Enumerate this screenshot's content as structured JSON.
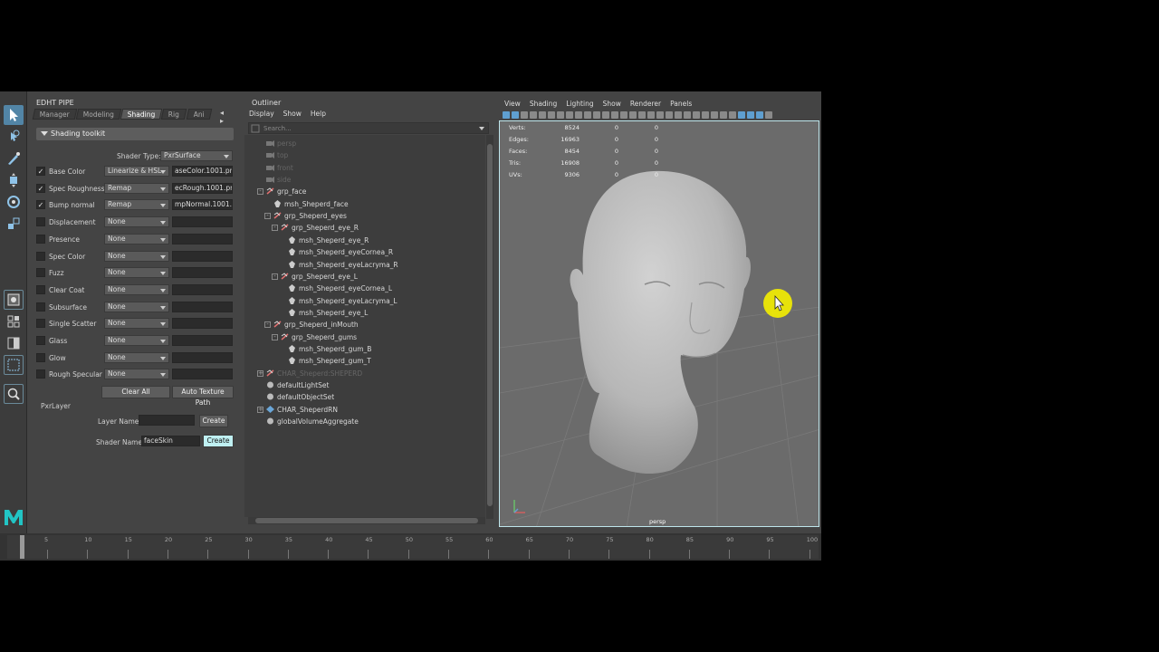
{
  "left_panel": {
    "title": "EDHT PIPE",
    "tabs": [
      {
        "label": "Manager",
        "active": false
      },
      {
        "label": "Modeling",
        "active": false
      },
      {
        "label": "Shading",
        "active": true
      },
      {
        "label": "Rig",
        "active": false
      },
      {
        "label": "Ani",
        "active": false
      }
    ],
    "tab_arrows": "◂ ▸",
    "toolkit_header": "Shading toolkit",
    "shader_type_label": "Shader Type:",
    "shader_type_value": "PxrSurface",
    "attributes": [
      {
        "label": "Base Color",
        "checked": true,
        "mode": "Linearize & HSL",
        "file": "aseColor.1001.png"
      },
      {
        "label": "Spec Roughness",
        "checked": true,
        "mode": "Remap",
        "file": "ecRough.1001.png"
      },
      {
        "label": "Bump normal",
        "checked": true,
        "mode": "Remap",
        "file": "mpNormal.1001.tif"
      },
      {
        "label": "Displacement",
        "checked": false,
        "mode": "None",
        "file": ""
      },
      {
        "label": "Presence",
        "checked": false,
        "mode": "None",
        "file": ""
      },
      {
        "label": "Spec Color",
        "checked": false,
        "mode": "None",
        "file": ""
      },
      {
        "label": "Fuzz",
        "checked": false,
        "mode": "None",
        "file": ""
      },
      {
        "label": "Clear Coat",
        "checked": false,
        "mode": "None",
        "file": ""
      },
      {
        "label": "Subsurface",
        "checked": false,
        "mode": "None",
        "file": ""
      },
      {
        "label": "Single Scatter",
        "checked": false,
        "mode": "None",
        "file": ""
      },
      {
        "label": "Glass",
        "checked": false,
        "mode": "None",
        "file": ""
      },
      {
        "label": "Glow",
        "checked": false,
        "mode": "None",
        "file": ""
      },
      {
        "label": "Rough Specular",
        "checked": false,
        "mode": "None",
        "file": ""
      }
    ],
    "clear_all": "Clear All",
    "auto_texture_path": "Auto Texture Path",
    "pxr_layer_label": "PxrLayer",
    "layer_name_label": "Layer Name:",
    "layer_name_value": "",
    "layer_create": "Create",
    "shader_name_label": "Shader Name:",
    "shader_name_value": "faceSkin",
    "shader_create": "Create"
  },
  "outliner": {
    "title": "Outliner",
    "menu": [
      "Display",
      "Show",
      "Help"
    ],
    "search_placeholder": "Search...",
    "items": [
      {
        "label": "persp",
        "depth": 0,
        "icon": "camera",
        "dim": true,
        "exp": ""
      },
      {
        "label": "top",
        "depth": 0,
        "icon": "camera",
        "dim": true,
        "exp": ""
      },
      {
        "label": "front",
        "depth": 0,
        "icon": "camera",
        "dim": true,
        "exp": ""
      },
      {
        "label": "side",
        "depth": 0,
        "icon": "camera",
        "dim": true,
        "exp": ""
      },
      {
        "label": "grp_face",
        "depth": 0,
        "icon": "group",
        "dim": false,
        "exp": "-"
      },
      {
        "label": "msh_Sheperd_face",
        "depth": 1,
        "icon": "mesh",
        "dim": false,
        "exp": ""
      },
      {
        "label": "grp_Sheperd_eyes",
        "depth": 1,
        "icon": "group",
        "dim": false,
        "exp": "-"
      },
      {
        "label": "grp_Sheperd_eye_R",
        "depth": 2,
        "icon": "group",
        "dim": false,
        "exp": "-"
      },
      {
        "label": "msh_Sheperd_eye_R",
        "depth": 3,
        "icon": "mesh",
        "dim": false,
        "exp": ""
      },
      {
        "label": "msh_Sheperd_eyeCornea_R",
        "depth": 3,
        "icon": "mesh",
        "dim": false,
        "exp": ""
      },
      {
        "label": "msh_Sheperd_eyeLacryma_R",
        "depth": 3,
        "icon": "mesh",
        "dim": false,
        "exp": ""
      },
      {
        "label": "grp_Sheperd_eye_L",
        "depth": 2,
        "icon": "group",
        "dim": false,
        "exp": "-"
      },
      {
        "label": "msh_Sheperd_eyeCornea_L",
        "depth": 3,
        "icon": "mesh",
        "dim": false,
        "exp": ""
      },
      {
        "label": "msh_Sheperd_eyeLacryma_L",
        "depth": 3,
        "icon": "mesh",
        "dim": false,
        "exp": ""
      },
      {
        "label": "msh_Sheperd_eye_L",
        "depth": 3,
        "icon": "mesh",
        "dim": false,
        "exp": ""
      },
      {
        "label": "grp_Sheperd_inMouth",
        "depth": 1,
        "icon": "group",
        "dim": false,
        "exp": "-"
      },
      {
        "label": "grp_Sheperd_gums",
        "depth": 2,
        "icon": "group",
        "dim": false,
        "exp": "-"
      },
      {
        "label": "msh_Sheperd_gum_B",
        "depth": 3,
        "icon": "mesh",
        "dim": false,
        "exp": ""
      },
      {
        "label": "msh_Sheperd_gum_T",
        "depth": 3,
        "icon": "mesh",
        "dim": false,
        "exp": ""
      },
      {
        "label": "CHAR_Sheperd:SHEPERD",
        "depth": 0,
        "icon": "group",
        "dim": true,
        "exp": "+"
      },
      {
        "label": "defaultLightSet",
        "depth": 0,
        "icon": "set",
        "dim": false,
        "exp": ""
      },
      {
        "label": "defaultObjectSet",
        "depth": 0,
        "icon": "set",
        "dim": false,
        "exp": ""
      },
      {
        "label": "CHAR_SheperdRN",
        "depth": 0,
        "icon": "reference",
        "dim": false,
        "exp": "+"
      },
      {
        "label": "globalVolumeAggregate",
        "depth": 0,
        "icon": "set",
        "dim": false,
        "exp": ""
      }
    ]
  },
  "viewport": {
    "menu": [
      "View",
      "Shading",
      "Lighting",
      "Show",
      "Renderer",
      "Panels"
    ],
    "hud": [
      {
        "label": "Verts:",
        "v1": "8524",
        "v2": "0",
        "v3": "0"
      },
      {
        "label": "Edges:",
        "v1": "16963",
        "v2": "0",
        "v3": "0"
      },
      {
        "label": "Faces:",
        "v1": "8454",
        "v2": "0",
        "v3": "0"
      },
      {
        "label": "Tris:",
        "v1": "16908",
        "v2": "0",
        "v3": "0"
      },
      {
        "label": "UVs:",
        "v1": "9306",
        "v2": "0",
        "v3": "0"
      }
    ],
    "camera_label": "persp"
  },
  "timeline": {
    "ticks": [
      "5",
      "10",
      "15",
      "20",
      "25",
      "30",
      "35",
      "40",
      "45",
      "50",
      "55",
      "60",
      "65",
      "70",
      "75",
      "80",
      "85",
      "90",
      "95",
      "100"
    ]
  },
  "colors": {
    "accent": "#5285a6",
    "highlight_button": "#bff0f2",
    "cursor_highlight": "#f5f000"
  }
}
